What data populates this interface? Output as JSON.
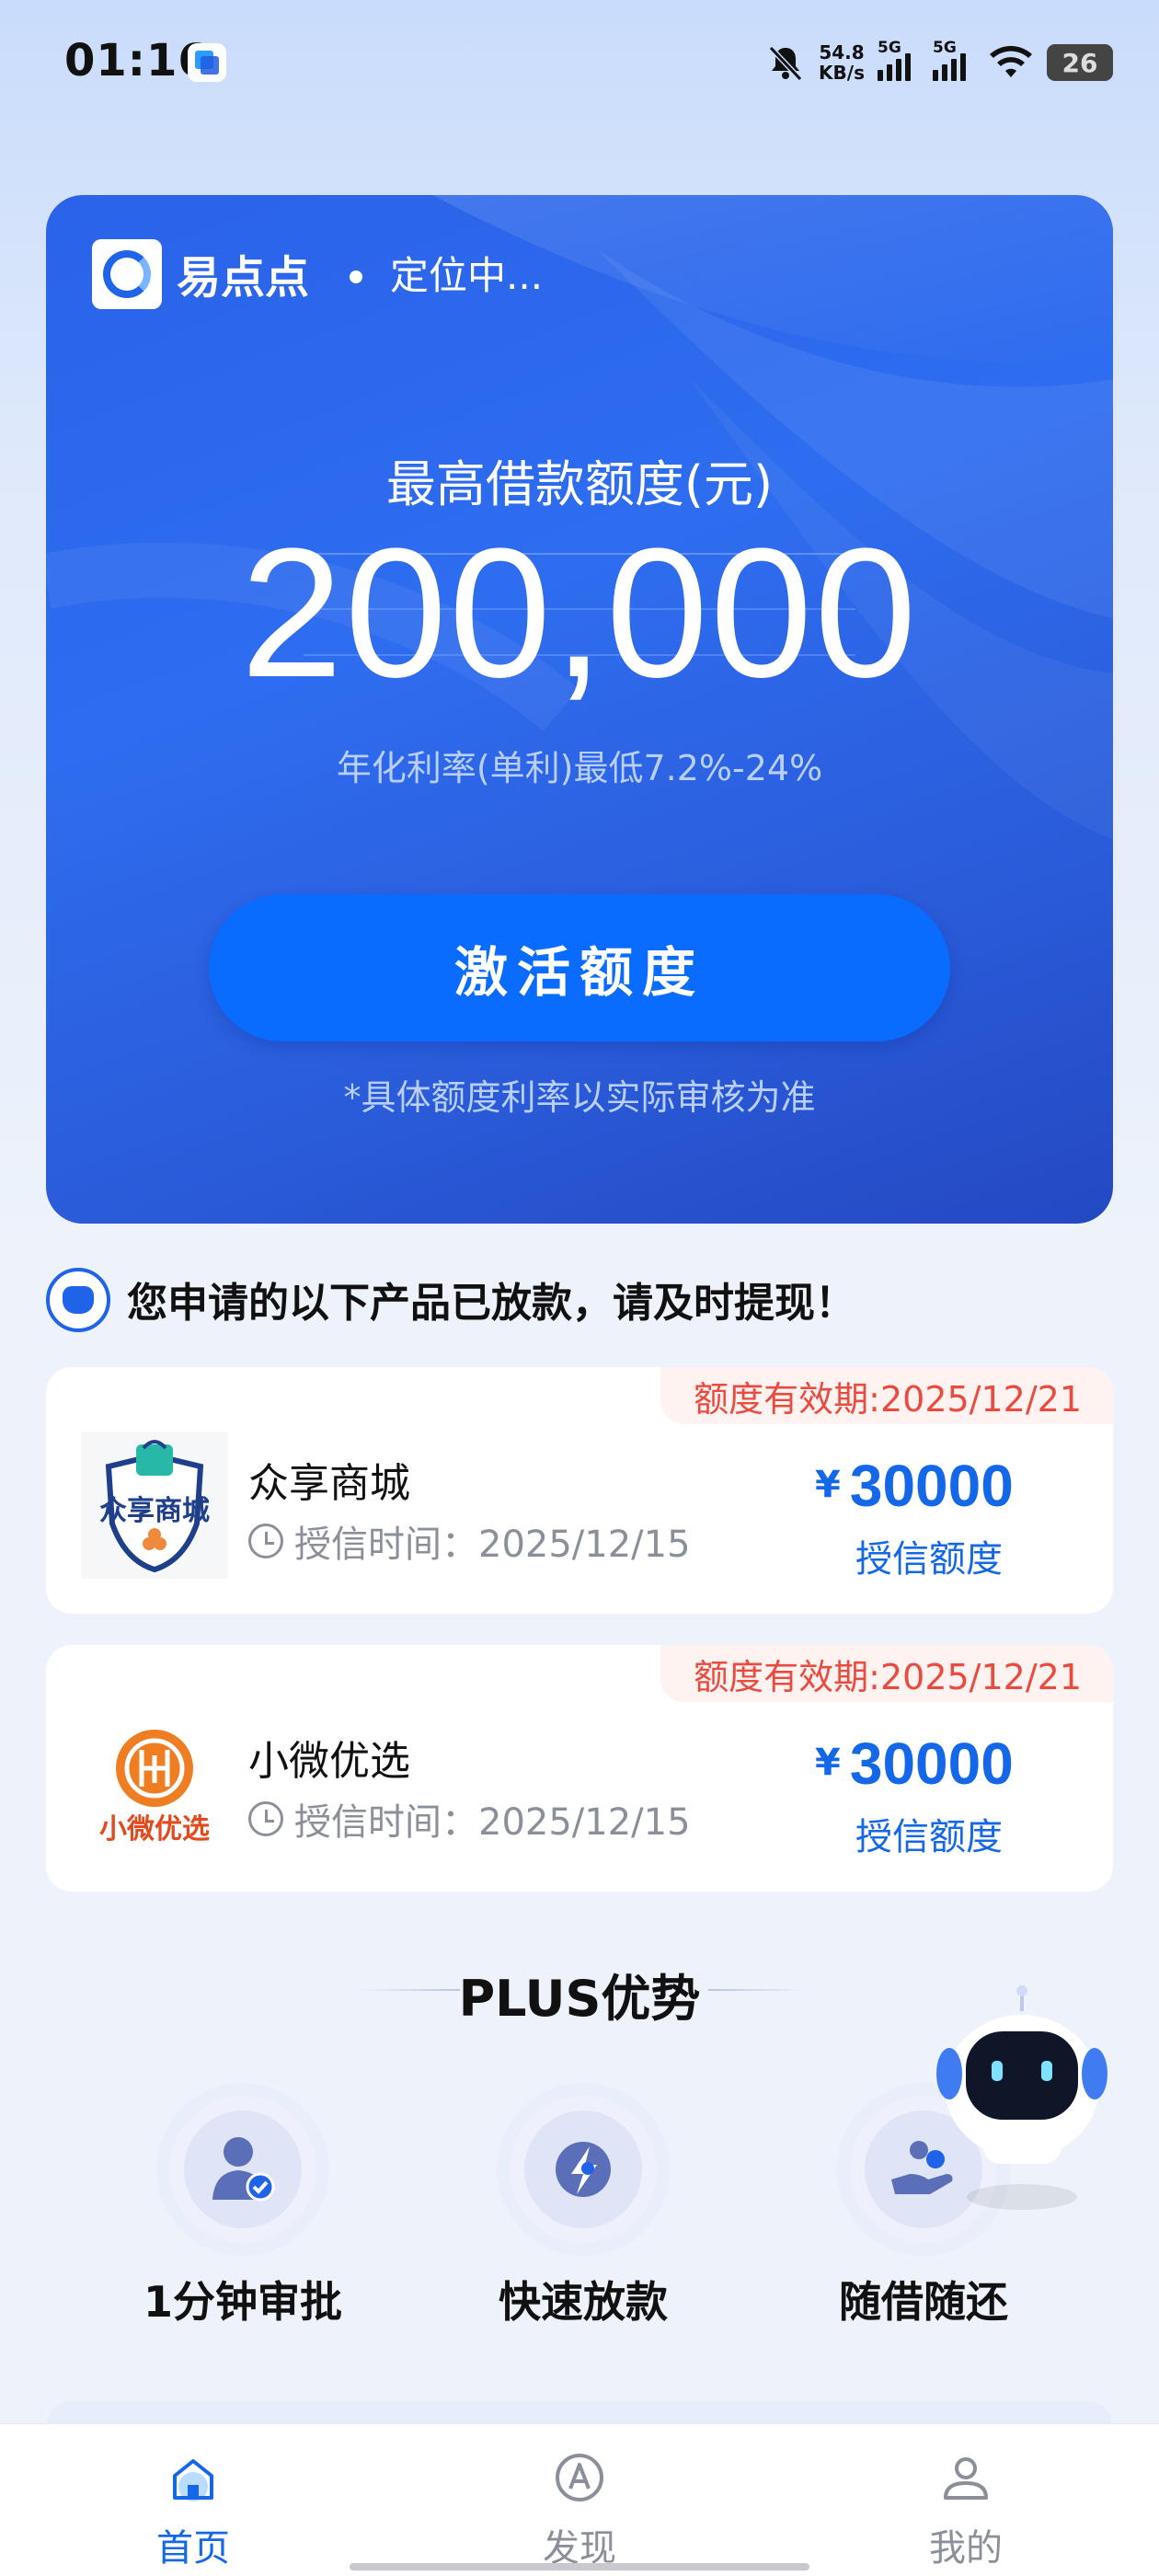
{
  "status_bar": {
    "time": "01:16",
    "net_speed_value": "54.8",
    "net_speed_unit": "KB/s",
    "sim1_label": "5G",
    "sim2_label": "5G",
    "battery": "26"
  },
  "hero": {
    "brand": "易点点",
    "location_status": "定位中...",
    "amount_label": "最高借款额度(元)",
    "amount": "200,000",
    "rate": "年化利率(单利)最低7.2%-24%",
    "activate_button": "激活额度",
    "note": "*具体额度利率以实际审核为准"
  },
  "notice": {
    "text": "您申请的以下产品已放款，请及时提现！"
  },
  "products": [
    {
      "validity": "额度有效期:2025/12/21",
      "logo_text": "众享商城",
      "name": "众享商城",
      "credit_time": "授信时间：2025/12/15",
      "currency": "¥",
      "amount": "30000",
      "amount_label": "授信额度"
    },
    {
      "validity": "额度有效期:2025/12/21",
      "logo_text": "小微优选",
      "name": "小微优选",
      "credit_time": "授信时间：2025/12/15",
      "currency": "¥",
      "amount": "30000",
      "amount_label": "授信额度"
    }
  ],
  "plus": {
    "title": "PLUS优势",
    "features": [
      {
        "label": "1分钟审批",
        "icon": "user-check-icon"
      },
      {
        "label": "快速放款",
        "icon": "lightning-icon"
      },
      {
        "label": "随借随还",
        "icon": "hand-coin-icon"
      }
    ]
  },
  "tabbar": {
    "items": [
      {
        "label": "首页",
        "icon": "home-icon",
        "active": true
      },
      {
        "label": "发现",
        "icon": "compass-icon",
        "active": false
      },
      {
        "label": "我的",
        "icon": "profile-icon",
        "active": false
      }
    ]
  },
  "colors": {
    "primary": "#1468e8",
    "hero_bg": "#2a63e8",
    "button": "#0a6cff",
    "warning": "#ea4b3f"
  }
}
